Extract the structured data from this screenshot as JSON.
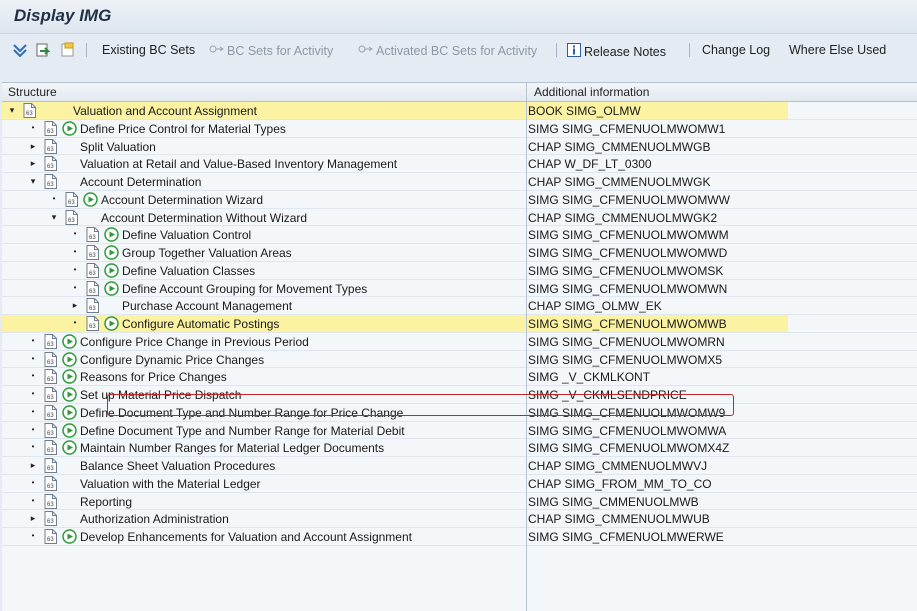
{
  "window": {
    "title": "Display IMG"
  },
  "toolbar": {
    "existing_bc_sets": "Existing BC Sets",
    "bc_sets_for_activity": "BC Sets for Activity",
    "activated_bc_sets": "Activated BC Sets for Activity",
    "release_notes": "Release Notes",
    "change_log": "Change Log",
    "where_else_used": "Where Else Used"
  },
  "columns": {
    "structure": "Structure",
    "additional_information": "Additional information"
  },
  "rows": [
    {
      "label": "Valuation and Account Assignment",
      "info": "BOOK SIMG_OLMW",
      "level": 0,
      "expander": "open",
      "activity": false,
      "highlight": true
    },
    {
      "label": "Define Price Control for Material Types",
      "info": "SIMG SIMG_CFMENUOLMWOMW1",
      "level": 1,
      "expander": "leaf",
      "activity": true
    },
    {
      "label": "Split Valuation",
      "info": "CHAP SIMG_CMMENUOLMWGB",
      "level": 1,
      "expander": "closed",
      "activity": false
    },
    {
      "label": "Valuation at Retail and Value-Based Inventory Management",
      "info": "CHAP W_DF_LT_0300",
      "level": 1,
      "expander": "closed",
      "activity": false
    },
    {
      "label": "Account Determination",
      "info": "CHAP SIMG_CMMENUOLMWGK",
      "level": 1,
      "expander": "open",
      "activity": false
    },
    {
      "label": "Account Determination Wizard",
      "info": "SIMG SIMG_CFMENUOLMWOMWW",
      "level": 2,
      "expander": "leaf",
      "activity": true
    },
    {
      "label": "Account Determination Without Wizard",
      "info": "CHAP SIMG_CMMENUOLMWGK2",
      "level": 2,
      "expander": "open",
      "activity": false
    },
    {
      "label": "Define Valuation Control",
      "info": "SIMG SIMG_CFMENUOLMWOMWM",
      "level": 3,
      "expander": "leaf",
      "activity": true
    },
    {
      "label": "Group Together Valuation Areas",
      "info": "SIMG SIMG_CFMENUOLMWOMWD",
      "level": 3,
      "expander": "leaf",
      "activity": true
    },
    {
      "label": "Define Valuation Classes",
      "info": "SIMG SIMG_CFMENUOLMWOMSK",
      "level": 3,
      "expander": "leaf",
      "activity": true
    },
    {
      "label": "Define Account Grouping for Movement Types",
      "info": "SIMG SIMG_CFMENUOLMWOMWN",
      "level": 3,
      "expander": "leaf",
      "activity": true
    },
    {
      "label": "Purchase Account Management",
      "info": "CHAP SIMG_OLMW_EK",
      "level": 3,
      "expander": "closed",
      "activity": false
    },
    {
      "label": "Configure Automatic Postings",
      "info": "SIMG SIMG_CFMENUOLMWOMWB",
      "level": 3,
      "expander": "leaf",
      "activity": true,
      "highlight": true,
      "selected": true
    },
    {
      "label": "Configure Price Change in Previous Period",
      "info": "SIMG SIMG_CFMENUOLMWOMRN",
      "level": 1,
      "expander": "leaf",
      "activity": true
    },
    {
      "label": "Configure Dynamic Price Changes",
      "info": "SIMG SIMG_CFMENUOLMWOMX5",
      "level": 1,
      "expander": "leaf",
      "activity": true
    },
    {
      "label": "Reasons for Price Changes",
      "info": "SIMG _V_CKMLKONT",
      "level": 1,
      "expander": "leaf",
      "activity": true
    },
    {
      "label": "Set up Material Price Dispatch",
      "info": "SIMG _V_CKMLSENDPRICE",
      "level": 1,
      "expander": "leaf",
      "activity": true
    },
    {
      "label": "Define Document Type and Number Range for Price Change",
      "info": "SIMG SIMG_CFMENUOLMWOMW9",
      "level": 1,
      "expander": "leaf",
      "activity": true
    },
    {
      "label": "Define Document Type and Number Range for Material Debit",
      "info": "SIMG SIMG_CFMENUOLMWOMWA",
      "level": 1,
      "expander": "leaf",
      "activity": true
    },
    {
      "label": "Maintain Number Ranges for Material Ledger Documents",
      "info": "SIMG SIMG_CFMENUOLMWOMX4Z",
      "level": 1,
      "expander": "leaf",
      "activity": true
    },
    {
      "label": "Balance Sheet Valuation Procedures",
      "info": "CHAP SIMG_CMMENUOLMWVJ",
      "level": 1,
      "expander": "closed",
      "activity": false
    },
    {
      "label": "Valuation with the Material Ledger",
      "info": "CHAP SIMG_FROM_MM_TO_CO",
      "level": 1,
      "expander": "leaf",
      "activity": false
    },
    {
      "label": "Reporting",
      "info": "SIMG SIMG_CMMENUOLMWB",
      "level": 1,
      "expander": "leaf",
      "activity": false
    },
    {
      "label": "Authorization Administration",
      "info": "CHAP SIMG_CMMENUOLMWUB",
      "level": 1,
      "expander": "closed",
      "activity": false
    },
    {
      "label": "Develop Enhancements for Valuation and Account Assignment",
      "info": "SIMG SIMG_CFMENUOLMWERWE",
      "level": 1,
      "expander": "leaf",
      "activity": true
    }
  ],
  "colors": {
    "highlight": "#fbf3a2",
    "selection_border": "#c0272d",
    "activity_icon": "#2e9a3a"
  }
}
